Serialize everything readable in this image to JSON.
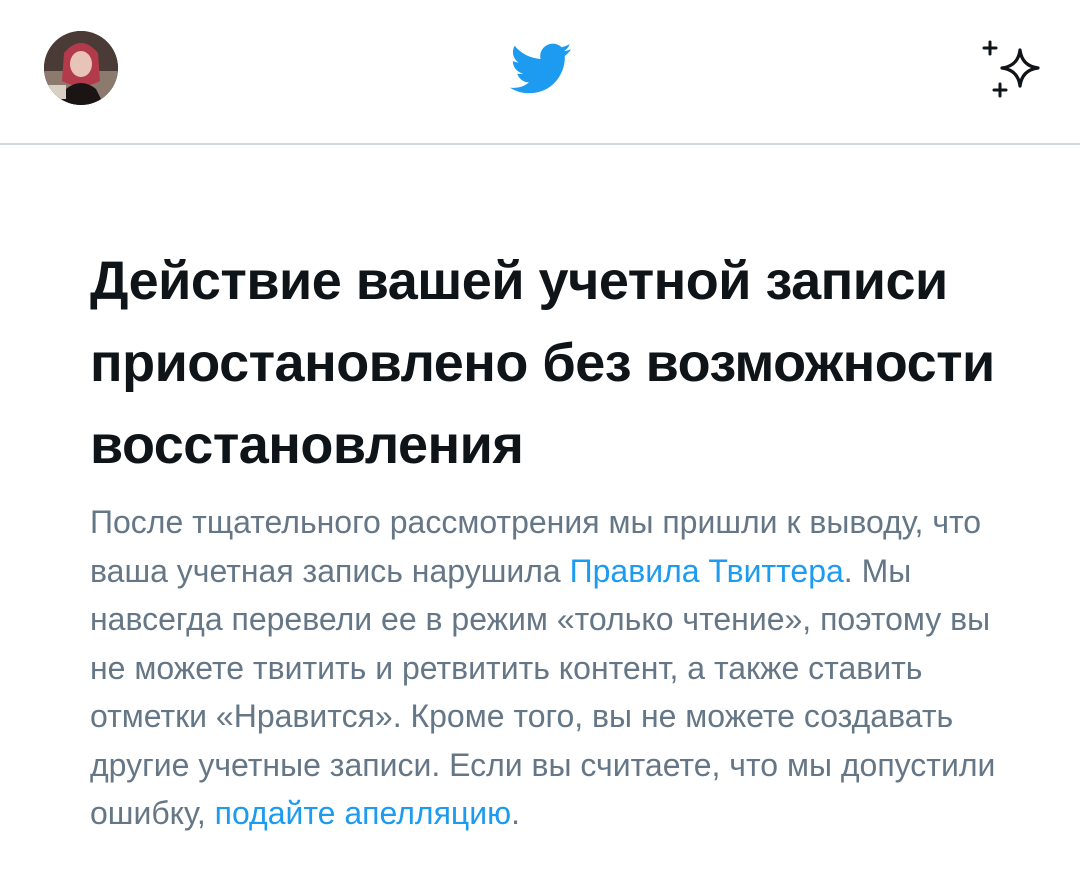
{
  "header": {
    "avatar_alt": "profile photo",
    "logo_icon": "twitter-bird-icon",
    "sparkle_icon": "sparkle-icon"
  },
  "notice": {
    "title": "Действие вашей учетной записи приостановлено без возможности восстановления",
    "body_part1": "После тщательного рассмотрения мы пришли к выводу, что ваша учетная запись нарушила ",
    "rules_link": "Правила Твиттера",
    "body_part2": ". Мы навсегда перевели ее в режим «только чтение», поэтому вы не можете твитить и ретвитить контент, а также ставить отметки «Нравится». Кроме того, вы не можете создавать другие учетные записи. Если вы считаете, что мы допустили ошибку, ",
    "appeal_link": "подайте апелляцию",
    "body_end": "."
  },
  "colors": {
    "brand_blue": "#1d9bf0",
    "text_dark": "#0f1419",
    "text_secondary": "#657786",
    "divider": "#cfd9de"
  }
}
